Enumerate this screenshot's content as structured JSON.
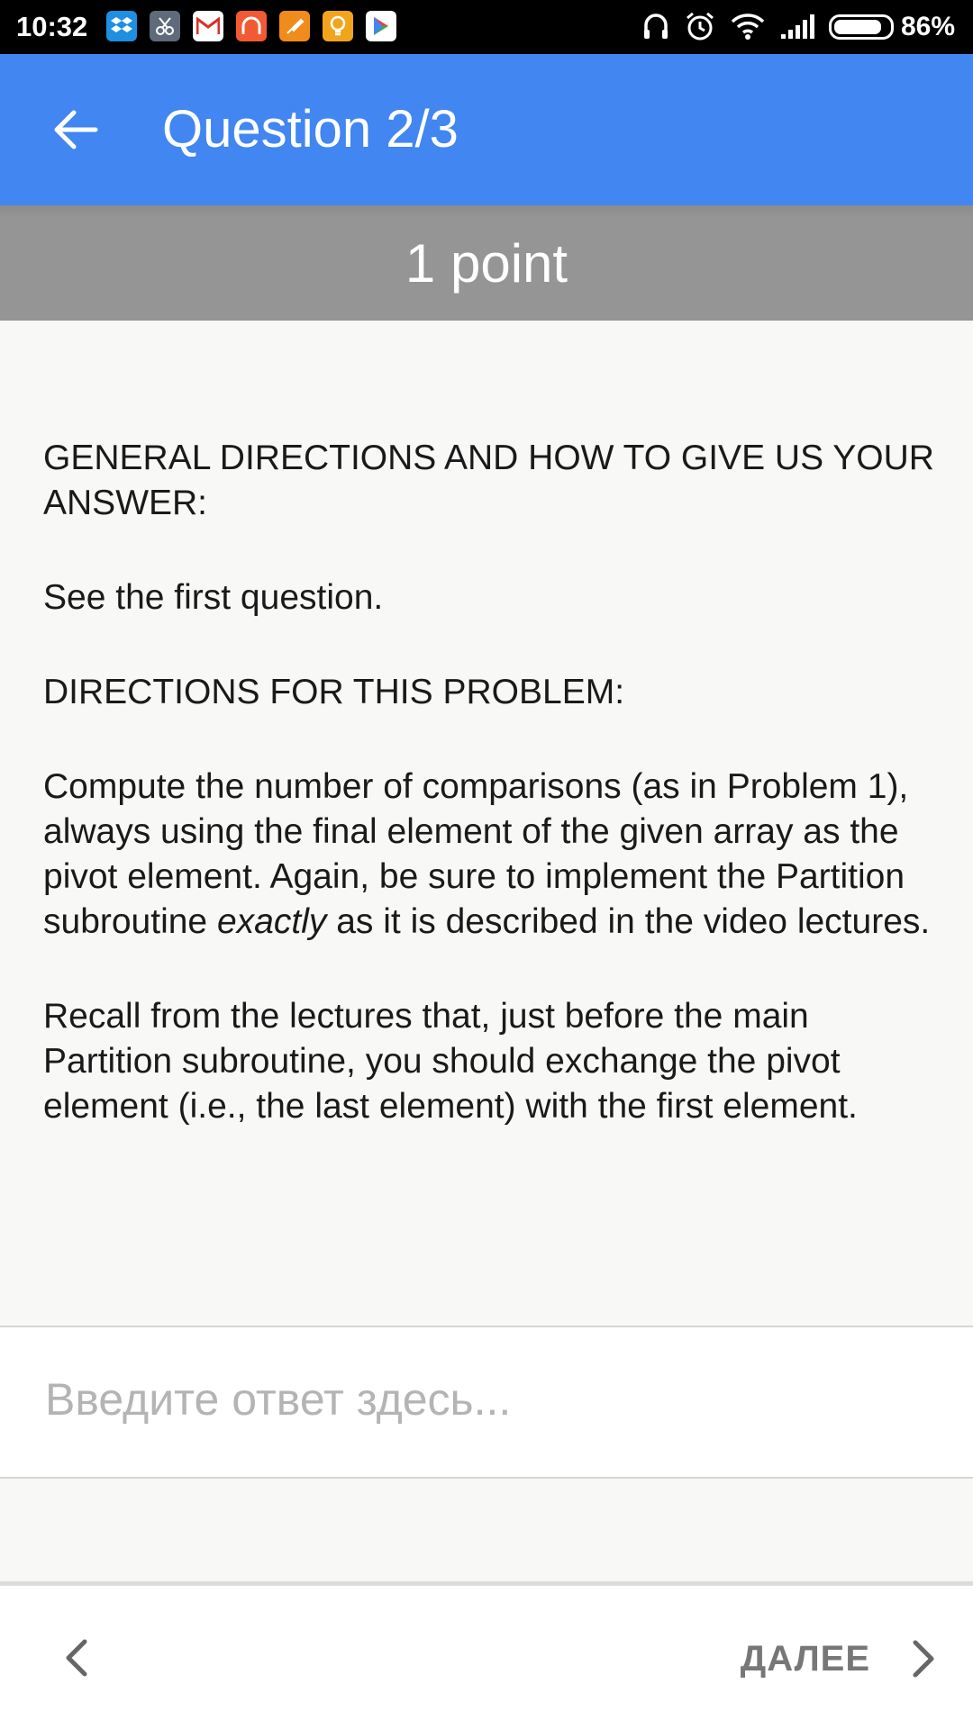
{
  "status_bar": {
    "time": "10:32",
    "battery_percent": "86%",
    "battery_level": 0.86,
    "notification_icons": [
      {
        "name": "dropbox-icon",
        "color": "#1e8fe1",
        "glyph": "❖"
      },
      {
        "name": "scissors-app-icon",
        "color": "#5f6b7a",
        "glyph": "✂"
      },
      {
        "name": "gmail-icon",
        "color": "#ffffff",
        "glyph": "M"
      },
      {
        "name": "headphones-app-icon",
        "color": "#f25a34",
        "glyph": "∩"
      },
      {
        "name": "brush-app-icon",
        "color": "#f08c1c",
        "glyph": "✎"
      },
      {
        "name": "lightbulb-app-icon",
        "color": "#f2a51c",
        "glyph": "💡"
      },
      {
        "name": "play-store-icon",
        "color": "#ffffff",
        "glyph": "▶"
      }
    ]
  },
  "app_bar": {
    "title": "Question 2/3",
    "color": "#4186f1"
  },
  "points": "1 point",
  "question": {
    "paragraphs": [
      "GENERAL DIRECTIONS AND HOW TO GIVE US YOUR ANSWER:",
      "See the first question.",
      "DIRECTIONS FOR THIS PROBLEM:",
      "Compute the number of comparisons (as in Problem 1), always using the final element of the given array as the pivot element. Again, be sure to implement the Partition subroutine",
      "exactly",
      "as it is described in the video lectures.",
      "Recall from the lectures that, just before the main Partition subroutine, you should exchange the pivot element (i.e., the last element) with the first element."
    ]
  },
  "answer": {
    "placeholder": "Введите ответ здесь...",
    "value": ""
  },
  "bottom_nav": {
    "next_label": "ДАЛЕЕ"
  }
}
